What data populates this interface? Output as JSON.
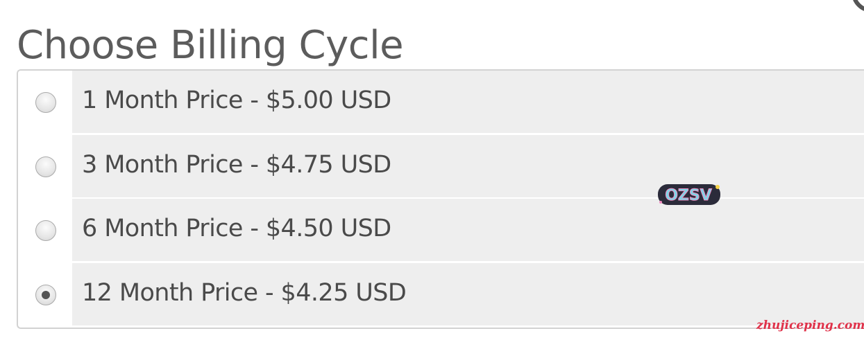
{
  "title": "Choose Billing Cycle",
  "options": [
    {
      "label": "1 Month Price - $5.00 USD",
      "selected": false
    },
    {
      "label": "3 Month Price - $4.75 USD",
      "selected": false
    },
    {
      "label": "6 Month Price - $4.50 USD",
      "selected": false
    },
    {
      "label": "12 Month Price - $4.25 USD",
      "selected": true
    }
  ],
  "logo_text": "OZSV",
  "watermark": "zhujiceping.com",
  "colors": {
    "title": "#5c5c5c",
    "option_background": "#eeeeee",
    "border": "#d2d2d2",
    "watermark": "#e0324a"
  }
}
